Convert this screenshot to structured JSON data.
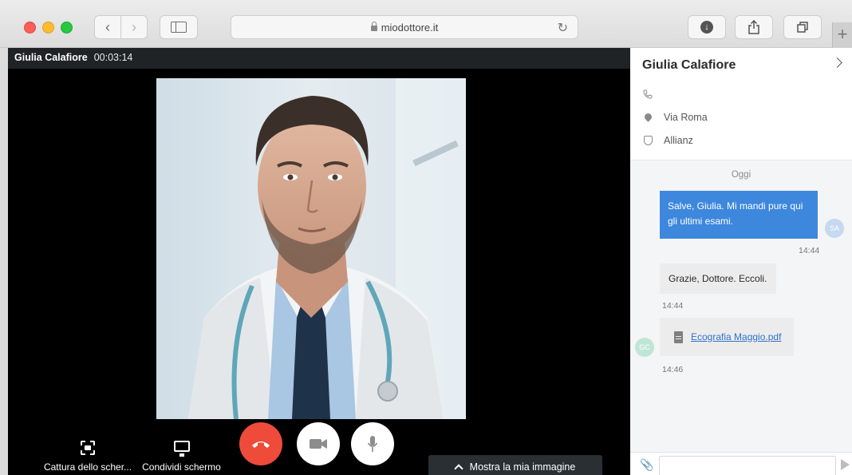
{
  "browser": {
    "url": "miodottore.it",
    "new_tab_label": "+"
  },
  "call": {
    "caller_name": "Giulia Calafiore",
    "timer": "00:03:14",
    "capture_label": "Cattura dello scher...",
    "share_label": "Condividi schermo",
    "show_image_label": "Mostra la mia immagine"
  },
  "panel": {
    "title": "Giulia Calafiore",
    "address": "Via Roma",
    "insurance": "Allianz"
  },
  "chat": {
    "day_label": "Oggi",
    "messages": [
      {
        "direction": "out",
        "text": "Salve, Giulia. Mi mandi pure qui gli ultimi esami.",
        "time": "14:44",
        "avatar": "SA"
      },
      {
        "direction": "in",
        "text": "Grazie, Dottore. Eccoli.",
        "time": "14:44"
      },
      {
        "direction": "in",
        "file": "Ecografia Maggio.pdf",
        "time": "14:46",
        "avatar": "GC"
      }
    ],
    "input_placeholder": ""
  },
  "colors": {
    "accent_blue": "#3d87dd",
    "hangup_red": "#ee4b3a",
    "link_blue": "#2f72c9"
  }
}
